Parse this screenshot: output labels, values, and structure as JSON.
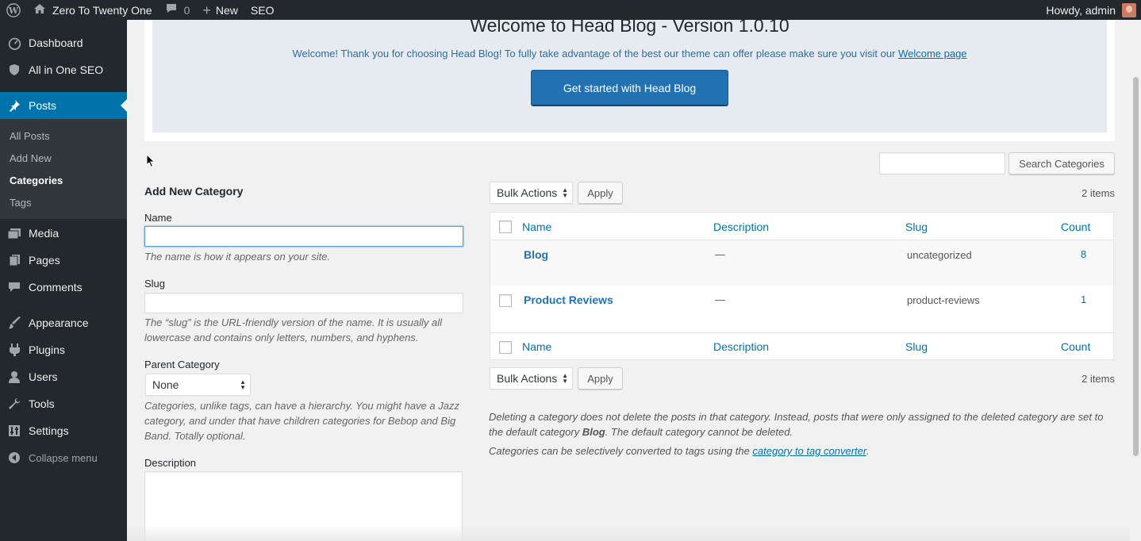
{
  "admin_bar": {
    "site_name": "Zero To Twenty One",
    "comments_count": "0",
    "new_label": "New",
    "seo_label": "SEO",
    "howdy": "Howdy, admin"
  },
  "sidebar": {
    "items": [
      {
        "label": "Dashboard",
        "icon": "dashboard-icon"
      },
      {
        "label": "All in One SEO",
        "icon": "shield-icon"
      },
      {
        "label": "Posts",
        "icon": "pushpin-icon"
      },
      {
        "label": "Media",
        "icon": "media-icon"
      },
      {
        "label": "Pages",
        "icon": "pages-icon"
      },
      {
        "label": "Comments",
        "icon": "comment-icon"
      },
      {
        "label": "Appearance",
        "icon": "paintbrush-icon"
      },
      {
        "label": "Plugins",
        "icon": "plugin-icon"
      },
      {
        "label": "Users",
        "icon": "users-icon"
      },
      {
        "label": "Tools",
        "icon": "wrench-icon"
      },
      {
        "label": "Settings",
        "icon": "settings-icon"
      },
      {
        "label": "Collapse menu",
        "icon": "collapse-icon"
      }
    ],
    "submenu": [
      "All Posts",
      "Add New",
      "Categories",
      "Tags"
    ]
  },
  "welcome": {
    "title": "Welcome to Head Blog - Version 1.0.10",
    "text": "Welcome! Thank you for choosing Head Blog! To fully take advantage of the best our theme can offer please make sure you visit our",
    "link": "Welcome page",
    "button": "Get started with Head Blog"
  },
  "search": {
    "button": "Search Categories",
    "value": ""
  },
  "form": {
    "title": "Add New Category",
    "name_label": "Name",
    "name_help": "The name is how it appears on your site.",
    "slug_label": "Slug",
    "slug_help": "The “slug” is the URL-friendly version of the name. It is usually all lowercase and contains only letters, numbers, and hyphens.",
    "parent_label": "Parent Category",
    "parent_value": "None",
    "parent_help": "Categories, unlike tags, can have a hierarchy. You might have a Jazz category, and under that have children categories for Bebop and Big Band. Totally optional.",
    "description_label": "Description"
  },
  "table": {
    "bulk_actions": "Bulk Actions",
    "apply": "Apply",
    "items_count": "2 items",
    "columns": [
      "Name",
      "Description",
      "Slug",
      "Count"
    ],
    "rows": [
      {
        "name": "Blog",
        "description": "—",
        "slug": "uncategorized",
        "count": "8"
      },
      {
        "name": "Product Reviews",
        "description": "—",
        "slug": "product-reviews",
        "count": "1"
      }
    ]
  },
  "notes": {
    "delete_pre": "Deleting a category does not delete the posts in that category. Instead, posts that were only assigned to the deleted category are set to the default category ",
    "default_cat": "Blog",
    "delete_post": ". The default category cannot be deleted.",
    "convert_pre": "Categories can be selectively converted to tags using the ",
    "convert_link": "category to tag converter",
    "convert_post": "."
  },
  "colors": {
    "admin_bar": "#23282d",
    "accent": "#0073aa",
    "primary_button": "#2271b1",
    "welcome_bg": "#e5ebf1"
  }
}
